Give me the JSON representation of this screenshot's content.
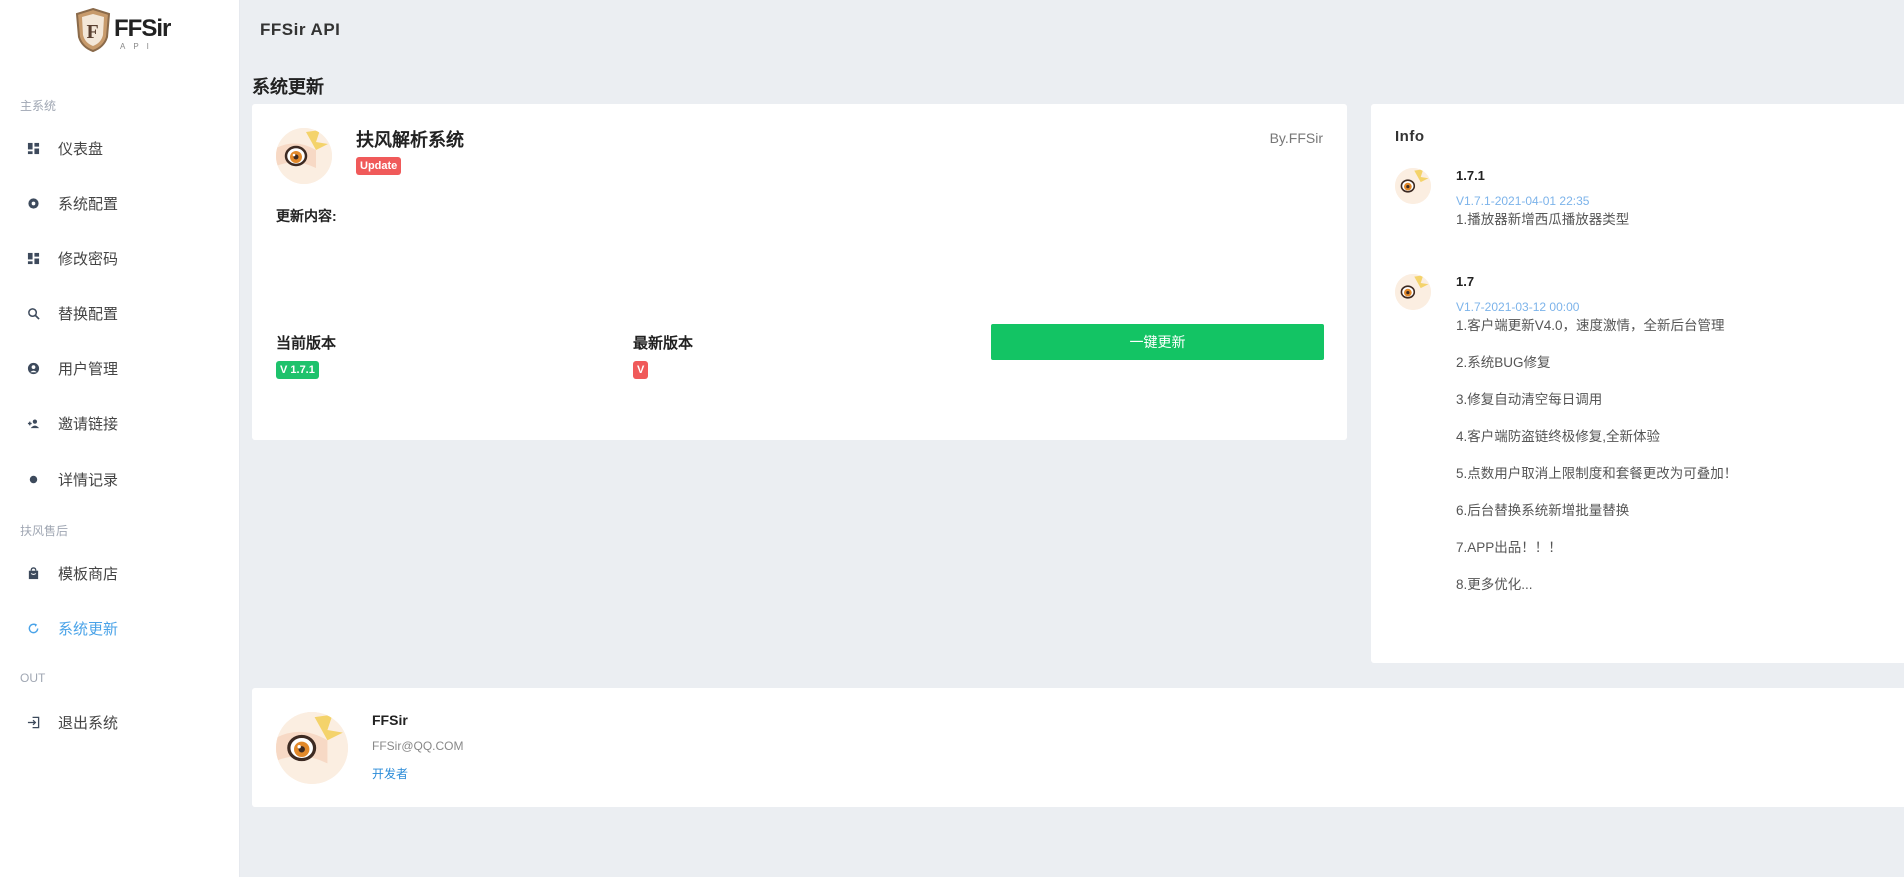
{
  "logo": {
    "brand": "FFSir",
    "sub": "API"
  },
  "header": {
    "title": "FFSir API"
  },
  "sidebar": {
    "sections": [
      {
        "label": "主系统"
      },
      {
        "label": "扶风售后"
      },
      {
        "label": "OUT"
      }
    ],
    "items": [
      {
        "label": "仪表盘",
        "icon": "dashboard-icon"
      },
      {
        "label": "系统配置",
        "icon": "settings-icon"
      },
      {
        "label": "修改密码",
        "icon": "grid-icon"
      },
      {
        "label": "替换配置",
        "icon": "search-replace-icon"
      },
      {
        "label": "用户管理",
        "icon": "user-icon"
      },
      {
        "label": "邀请链接",
        "icon": "user-group-icon"
      },
      {
        "label": "详情记录",
        "icon": "dot-icon"
      },
      {
        "label": "模板商店",
        "icon": "shop-icon"
      },
      {
        "label": "系统更新",
        "icon": "refresh-icon",
        "active": true
      },
      {
        "label": "退出系统",
        "icon": "logout-icon"
      }
    ]
  },
  "page": {
    "title": "系统更新"
  },
  "update": {
    "name": "扶风解析系统",
    "badge": "Update",
    "byline": "By.FFSir",
    "content_label": "更新内容:",
    "current_label": "当前版本",
    "current_value": "V 1.7.1",
    "latest_label": "最新版本",
    "latest_value": "V",
    "button": "一键更新",
    "accent": "#13c464"
  },
  "info": {
    "title": "Info",
    "logs": [
      {
        "version": "1.7.1",
        "date": "V1.7.1-2021-04-01 22:35",
        "lines": [
          "1.播放器新增西瓜播放器类型"
        ]
      },
      {
        "version": "1.7",
        "date": "V1.7-2021-03-12 00:00",
        "lines": [
          "1.客户端更新V4.0，速度激情，全新后台管理",
          "2.系统BUG修复",
          "3.修复自动清空每日调用",
          "4.客户端防盗链终极修复,全新体验",
          "5.点数用户取消上限制度和套餐更改为可叠加！",
          "6.后台替换系统新增批量替换",
          "7.APP出品！！！",
          "8.更多优化..."
        ]
      }
    ]
  },
  "developer": {
    "name": "FFSir",
    "email": "FFSir@QQ.COM",
    "role": "开发者"
  }
}
